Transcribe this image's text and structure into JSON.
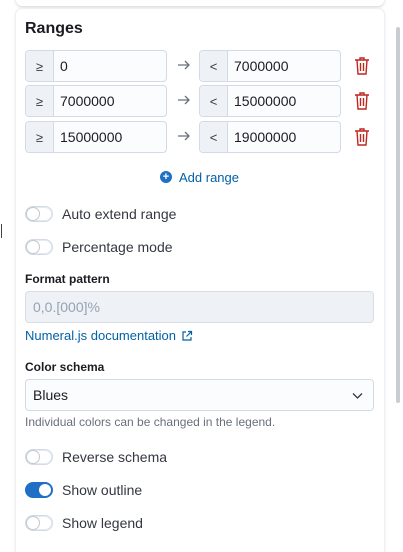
{
  "panel": {
    "title": "Ranges"
  },
  "ranges": [
    {
      "from_prefix": "≥",
      "from": "0",
      "to_prefix": "<",
      "to": "7000000"
    },
    {
      "from_prefix": "≥",
      "from": "7000000",
      "to_prefix": "<",
      "to": "15000000"
    },
    {
      "from_prefix": "≥",
      "from": "15000000",
      "to_prefix": "<",
      "to": "19000000"
    }
  ],
  "add_range": {
    "label": "Add range"
  },
  "toggles": {
    "auto_extend": {
      "label": "Auto extend range",
      "on": false
    },
    "percentage_mode": {
      "label": "Percentage mode",
      "on": false
    },
    "reverse_schema": {
      "label": "Reverse schema",
      "on": false
    },
    "show_outline": {
      "label": "Show outline",
      "on": true
    },
    "show_legend": {
      "label": "Show legend",
      "on": false
    }
  },
  "format_pattern": {
    "label": "Format pattern",
    "placeholder": "0,0.[000]%"
  },
  "numeral_link": {
    "label": "Numeral.js documentation"
  },
  "color_schema": {
    "label": "Color schema",
    "value": "Blues",
    "help": "Individual colors can be changed in the legend."
  },
  "colors": {
    "accent": "#1f6fc4",
    "link": "#0061a6",
    "danger": "#bd271e"
  }
}
